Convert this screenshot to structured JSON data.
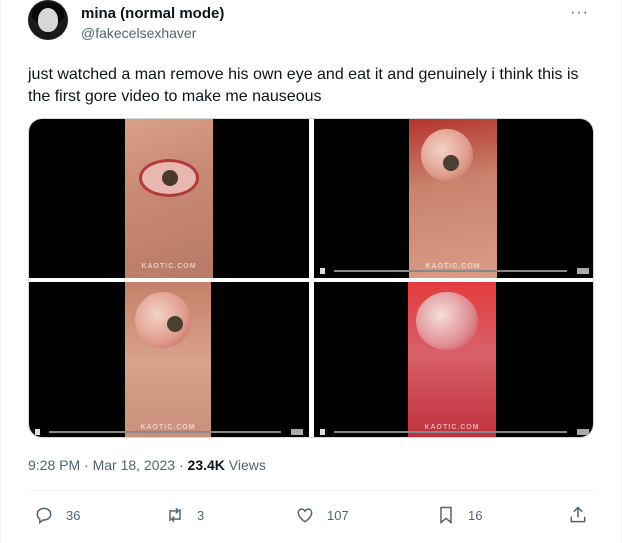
{
  "user": {
    "display_name": "mina (normal mode)",
    "handle": "@fakecelsexhaver"
  },
  "more_label": "···",
  "tweet_text": "just watched a man remove his own eye and eat it and genuinely i think this is the first gore video to make me nauseous",
  "media": {
    "watermark": "KAOTIC.COM"
  },
  "meta": {
    "time": "9:28 PM · Mar 18, 2023 · ",
    "views_count": "23.4K",
    "views_label": " Views"
  },
  "actions": {
    "replies": "36",
    "retweets": "3",
    "likes": "107",
    "bookmarks": "16"
  },
  "icons": [
    "reply-icon",
    "retweet-icon",
    "like-icon",
    "bookmark-icon",
    "share-icon"
  ]
}
